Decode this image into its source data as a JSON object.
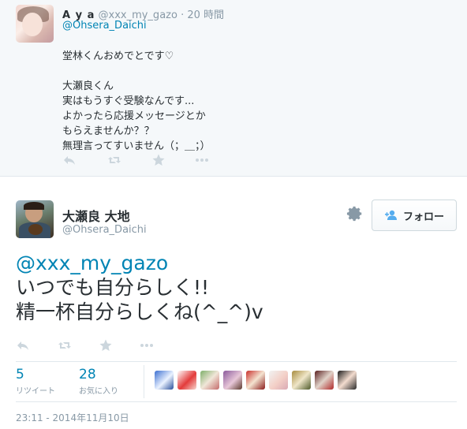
{
  "reply_tweet": {
    "author_name": "A y a",
    "author_handle": "@xxx_my_gazo",
    "separator": "·",
    "time": "20 時間",
    "mention": "@Ohsera_Daichi",
    "text": "堂林くんおめでとです♡\n\n大瀬良くん\n実はもうすぐ受験なんです...\nよかったら応援メッセージとか\nもらえませんか？？\n無理言ってすいません（；＿；）",
    "icons": [
      "reply-icon",
      "retweet-icon",
      "favorite-icon",
      "more-icon"
    ]
  },
  "main_tweet": {
    "author_name": "大瀬良 大地",
    "author_handle": "@Ohsera_Daichi",
    "follow_label": "フォロー",
    "mention": "@xxx_my_gazo",
    "lines": [
      "いつでも自分らしく!!",
      "精一杯自分らしくね(^_^)v"
    ],
    "icons": [
      "reply-icon",
      "retweet-icon",
      "favorite-icon",
      "more-icon",
      "gear-icon",
      "follow-user-icon"
    ],
    "stats": {
      "retweets": {
        "count": "5",
        "label": "リツイート"
      },
      "favorites": {
        "count": "28",
        "label": "お気に入り"
      }
    },
    "timestamp": "23:11 - 2014年11月10日"
  },
  "colors": {
    "link": "#0084b4",
    "muted": "#8899a6",
    "action_icon": "#ccd6dd",
    "follow_icon": "#55acee",
    "reply_background": "#f5f8fa"
  }
}
